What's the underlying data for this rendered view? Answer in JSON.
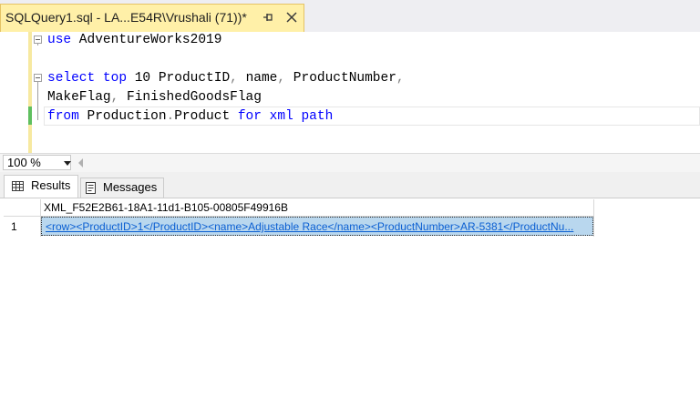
{
  "tab": {
    "title": "SQLQuery1.sql - LA...E54R\\Vrushali (71))*",
    "pin_icon": "pin-icon",
    "close_icon": "close-icon"
  },
  "editor": {
    "line1_kw": "use",
    "line1_rest": " AdventureWorks2019",
    "line3_kw1": "select",
    "line3_kw2": "top",
    "line3_num": " 10 ",
    "line3_a": "ProductID",
    "line3_c1": ",",
    "line3_b": "name",
    "line3_c2": ",",
    "line3_d": " ProductNumber",
    "line3_c3": ",",
    "line4_a": "MakeFlag",
    "line4_c": ",",
    "line4_b": " FinishedGoodsFlag",
    "line5_kw1": "from",
    "line5_obj": " Production",
    "line5_dot": ".",
    "line5_tbl": "Product ",
    "line5_kw2": "for",
    "line5_kw3": "xml",
    "line5_kw4": "path"
  },
  "zoom": {
    "value": "100 %"
  },
  "results": {
    "tabs": [
      {
        "label": "Results",
        "icon": "grid-icon"
      },
      {
        "label": "Messages",
        "icon": "messages-icon"
      }
    ],
    "column_header": "XML_F52E2B61-18A1-11d1-B105-00805F49916B",
    "rows": [
      {
        "num": "1",
        "value": "<row><ProductID>1</ProductID><name>Adjustable Race</name><ProductNumber>AR-5381</ProductNu..."
      }
    ]
  },
  "colors": {
    "tab_active": "#fff0a8",
    "keyword": "#0000ff",
    "selection": "#b9d7ee",
    "link": "#0b5fd2"
  }
}
